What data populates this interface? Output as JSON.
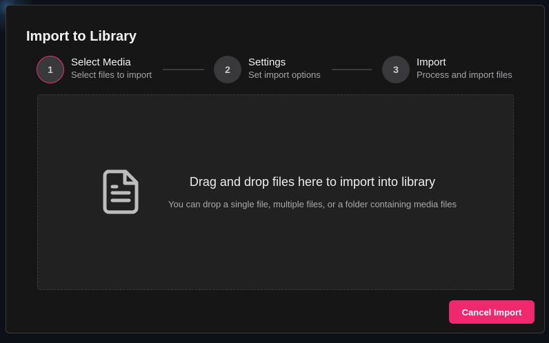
{
  "dialog": {
    "title": "Import to Library",
    "cancel_label": "Cancel Import"
  },
  "steps": [
    {
      "number": "1",
      "title": "Select Media",
      "description": "Select files to import",
      "active": true
    },
    {
      "number": "2",
      "title": "Settings",
      "description": "Set import options",
      "active": false
    },
    {
      "number": "3",
      "title": "Import",
      "description": "Process and import files",
      "active": false
    }
  ],
  "dropzone": {
    "icon": "file-text-icon",
    "title": "Drag and drop files here to import into library",
    "subtitle": "You can drop a single file, multiple files, or a folder containing media files"
  },
  "colors": {
    "accent": "#f0286e",
    "active_ring": "#e5336f",
    "dialog_bg": "#161617",
    "dropzone_bg": "#212122"
  }
}
